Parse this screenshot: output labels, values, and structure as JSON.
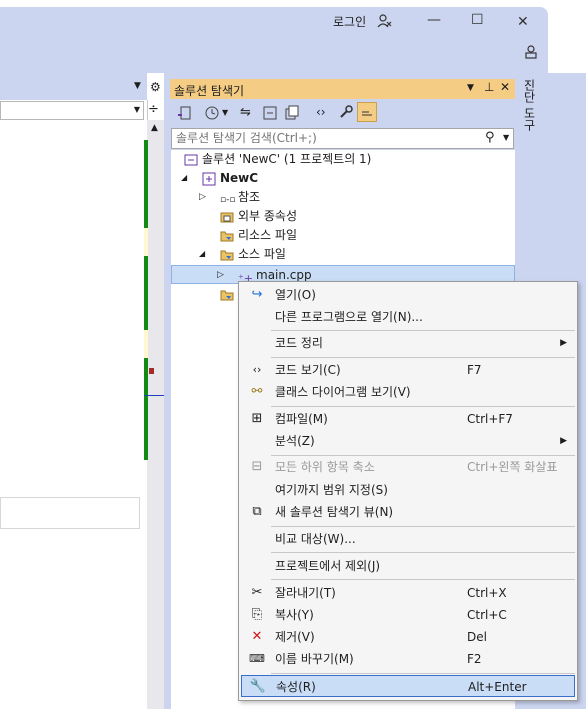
{
  "window": {
    "login_label": "로그인",
    "minimize_symbol": "—",
    "maximize_symbol": "☐",
    "close_symbol": "✕"
  },
  "solution_explorer": {
    "title": "솔루션 탐색기",
    "search_placeholder": "솔루션 탐색기 검색(Ctrl+;)",
    "side_tab_label": "진단 도구",
    "tree": [
      {
        "label": "솔루션 'NewC' (1 프로젝트의 1)",
        "icon": "solution-icon"
      },
      {
        "label": "NewC",
        "icon": "project-icon",
        "bold": true
      },
      {
        "label": "참조",
        "icon": "references-icon"
      },
      {
        "label": "외부 종속성",
        "icon": "external-deps-icon"
      },
      {
        "label": "리소스 파일",
        "icon": "folder-icon"
      },
      {
        "label": "소스 파일",
        "icon": "folder-icon"
      },
      {
        "label": "main.cpp",
        "icon": "cpp-file-icon",
        "selected": true
      },
      {
        "label": "",
        "icon": "folder-icon"
      }
    ]
  },
  "context_menu": {
    "items": [
      {
        "label": "열기(O)",
        "shortcut": "",
        "icon": "open-icon"
      },
      {
        "label": "다른 프로그램으로 열기(N)...",
        "shortcut": ""
      },
      {
        "label": "코드 정리",
        "shortcut": "",
        "submenu": true
      },
      {
        "label": "코드 보기(C)",
        "shortcut": "F7",
        "icon": "code-icon"
      },
      {
        "label": "클래스 다이어그램 보기(V)",
        "shortcut": "",
        "icon": "class-diagram-icon"
      },
      {
        "label": "컴파일(M)",
        "shortcut": "Ctrl+F7",
        "icon": "compile-icon"
      },
      {
        "label": "분석(Z)",
        "shortcut": "",
        "submenu": true
      },
      {
        "label": "모든 하위 항목 축소",
        "shortcut": "Ctrl+왼쪽 화살표",
        "icon": "collapse-icon",
        "disabled": true
      },
      {
        "label": "여기까지 범위 지정(S)",
        "shortcut": ""
      },
      {
        "label": "새 솔루션 탐색기 뷰(N)",
        "shortcut": "",
        "icon": "new-view-icon"
      },
      {
        "label": "비교 대상(W)...",
        "shortcut": ""
      },
      {
        "label": "프로젝트에서 제외(J)",
        "shortcut": ""
      },
      {
        "label": "잘라내기(T)",
        "shortcut": "Ctrl+X",
        "icon": "cut-icon"
      },
      {
        "label": "복사(Y)",
        "shortcut": "Ctrl+C",
        "icon": "copy-icon"
      },
      {
        "label": "제거(V)",
        "shortcut": "Del",
        "icon": "delete-icon"
      },
      {
        "label": "이름 바꾸기(M)",
        "shortcut": "F2",
        "icon": "rename-icon"
      },
      {
        "label": "속성(R)",
        "shortcut": "Alt+Enter",
        "icon": "properties-icon",
        "highlighted": true
      }
    ]
  },
  "colors": {
    "titlebar": "#ccd5f0",
    "panel_header": "#f5cc84",
    "selection": "#c9ddf6",
    "menu_bg": "#f5f5f5"
  }
}
